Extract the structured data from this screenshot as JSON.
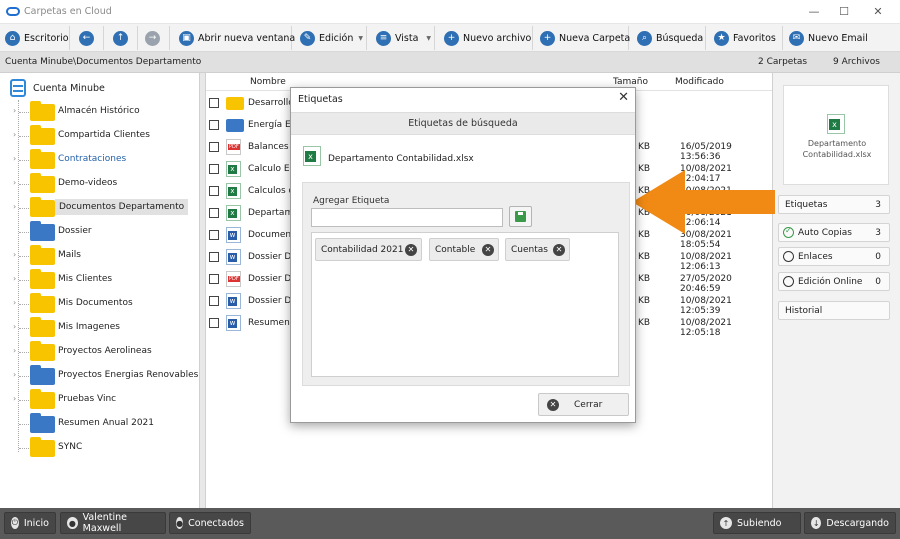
{
  "window": {
    "title": "Carpetas en Cloud",
    "minimize": "—",
    "maximize": "☐",
    "close": "✕"
  },
  "toolbar": {
    "escritorio": "Escritorio",
    "abrir": "Abrir nueva ventana",
    "edicion": "Edición",
    "vista": "Vista",
    "nuevo_archivo": "Nuevo archivo",
    "nueva_carpeta": "Nueva Carpeta",
    "busqueda": "Búsqueda",
    "favoritos": "Favoritos",
    "nuevo_email": "Nuevo Email"
  },
  "path": {
    "text": "Cuenta Minube\\Documentos Departamento",
    "carpetas": "2 Carpetas",
    "archivos": "9 Archivos"
  },
  "tree": {
    "root": "Cuenta Minube",
    "items": [
      {
        "label": "Almacén Histórico",
        "color": "#f8c400"
      },
      {
        "label": "Compartida Clientes",
        "color": "#f8c400"
      },
      {
        "label": "Contrataciones",
        "color": "#f8c400"
      },
      {
        "label": "Demo-videos",
        "color": "#f8c400"
      },
      {
        "label": "Documentos Departamento",
        "color": "#f8c400"
      },
      {
        "label": "Dossier",
        "color": "#3a78c5"
      },
      {
        "label": "Mails",
        "color": "#f8c400"
      },
      {
        "label": "Mis Clientes",
        "color": "#f8c400"
      },
      {
        "label": "Mis Documentos",
        "color": "#f8c400"
      },
      {
        "label": "Mis Imagenes",
        "color": "#f8c400"
      },
      {
        "label": "Proyectos Aerolineas",
        "color": "#f8c400"
      },
      {
        "label": "Proyectos Energias Renovables",
        "color": "#3a78c5"
      },
      {
        "label": "Pruebas Vinc",
        "color": "#f8c400"
      },
      {
        "label": "Resumen Anual 2021",
        "color": "#3a78c5"
      },
      {
        "label": "SYNC",
        "color": "#f8c400"
      }
    ]
  },
  "files": {
    "headers": {
      "name": "Nombre",
      "size": "Tamaño",
      "modified": "Modificado"
    },
    "rows": [
      {
        "name": "Desarrollos",
        "size": "",
        "date": ""
      },
      {
        "name": "Energía Eó",
        "size": "",
        "date": ""
      },
      {
        "name": "Balances tr",
        "size": "KB",
        "date": "16/05/2019 13:56:36"
      },
      {
        "name": "Calculo En",
        "size": "KB",
        "date": "10/08/2021 12:04:17"
      },
      {
        "name": "Calculos d",
        "size": "KB",
        "date": "10/08/2021 12:04:29"
      },
      {
        "name": "Departame",
        "size": "KB",
        "date": "10/08/2021 12:06:14"
      },
      {
        "name": "Document",
        "size": "KB",
        "date": "30/08/2021 18:05:54"
      },
      {
        "name": "Dossier Da",
        "size": "KB",
        "date": "10/08/2021 12:06:13"
      },
      {
        "name": "Dossier Da",
        "size": "KB",
        "date": "27/05/2020 20:46:59"
      },
      {
        "name": "Dossier Da",
        "size": "KB",
        "date": "10/08/2021 12:05:39"
      },
      {
        "name": "Resumen F",
        "size": "KB",
        "date": "10/08/2021 12:05:18"
      }
    ]
  },
  "right": {
    "preview_name": "Departamento Contabilidad.xlsx",
    "etiquetas": "Etiquetas",
    "etiquetas_count": "3",
    "auto": "Auto Copias",
    "auto_count": "3",
    "enlaces": "Enlaces",
    "enlaces_count": "0",
    "online": "Edición Online",
    "online_count": "0",
    "historial": "Historial"
  },
  "status": {
    "inicio": "Inicio",
    "user": "Valentine Maxwell",
    "conectados": "Conectados",
    "subiendo": "Subiendo",
    "descargando": "Descargando"
  },
  "dialog": {
    "title": "Etiquetas",
    "header": "Etiquetas de búsqueda",
    "filename": "Departamento Contabilidad.xlsx",
    "add_label": "Agregar Etiqueta",
    "input_value": "",
    "tags": [
      "Contabilidad 2021",
      "Contable",
      "Cuentas"
    ],
    "cancel": "Cerrar"
  },
  "colors": {
    "accent": "#2f6fb3",
    "arrow": "#f08a14",
    "status_bg": "#5a5a5a"
  }
}
